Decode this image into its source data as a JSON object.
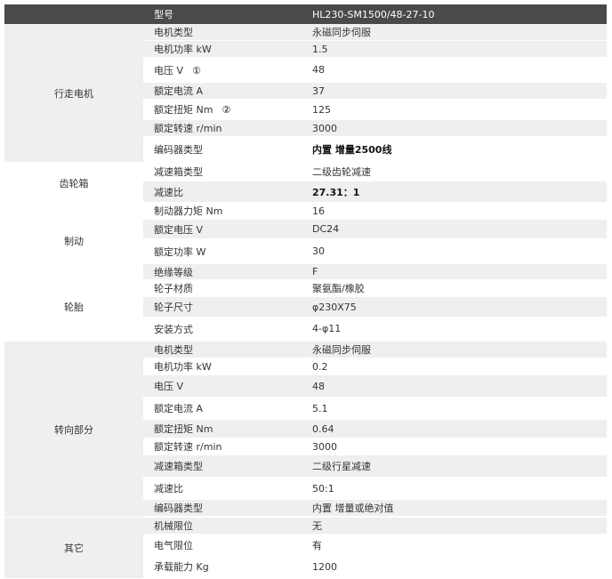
{
  "header": {
    "model_label": "型号",
    "model_value": "HL230-SM1500/48-27-10"
  },
  "groups": {
    "drive_motor": "行走电机",
    "gearbox": "齿轮箱",
    "brake": "制动",
    "tire": "轮胎",
    "steering": "转向部分",
    "other": "其它"
  },
  "drive_motor_rows": [
    {
      "label": "电机类型",
      "value": "永磁同步伺服"
    },
    {
      "label": "电机功率 kW",
      "value": "1.5"
    },
    {
      "label": "电压 V",
      "mark": "①",
      "value": "48"
    },
    {
      "label": "额定电流 A",
      "value": "37"
    },
    {
      "label": "额定扭矩 Nm",
      "mark": "②",
      "value": "125"
    },
    {
      "label": "额定转速 r/min",
      "value": "3000"
    },
    {
      "label": "编码器类型",
      "value": "内置 增量2500线"
    }
  ],
  "gearbox_rows": [
    {
      "label": "减速箱类型",
      "value": "二级齿轮减速"
    },
    {
      "label": "减速比",
      "value": "27.31：1"
    }
  ],
  "brake_rows": [
    {
      "label": "制动器力矩 Nm",
      "value": "16"
    },
    {
      "label": "额定电压 V",
      "value": "DC24"
    },
    {
      "label": "额定功率 W",
      "value": "30"
    },
    {
      "label": "绝缘等级",
      "value": "F"
    }
  ],
  "tire_rows": [
    {
      "label": "轮子材质",
      "value": "聚氨酯/橡胶"
    },
    {
      "label": "轮子尺寸",
      "value": "φ230X75"
    },
    {
      "label": "安装方式",
      "value": "4-φ11"
    }
  ],
  "steering_rows": [
    {
      "label": "电机类型",
      "value": "永磁同步伺服"
    },
    {
      "label": "电机功率 kW",
      "value": "0.2"
    },
    {
      "label": "电压 V",
      "value": "48"
    },
    {
      "label": "额定电流 A",
      "value": "5.1"
    },
    {
      "label": "额定扭矩 Nm",
      "value": "0.64"
    },
    {
      "label": "额定转速 r/min",
      "value": "3000"
    },
    {
      "label": "减速箱类型",
      "value": "二级行星减速"
    },
    {
      "label": "减速比",
      "value": "50:1"
    },
    {
      "label": "编码器类型",
      "value": "内置 增量或绝对值"
    }
  ],
  "other_rows": [
    {
      "label": "机械限位",
      "value": "无"
    },
    {
      "label": "电气限位",
      "value": "有"
    },
    {
      "label": "承载能力 Kg",
      "value": "1200"
    }
  ]
}
